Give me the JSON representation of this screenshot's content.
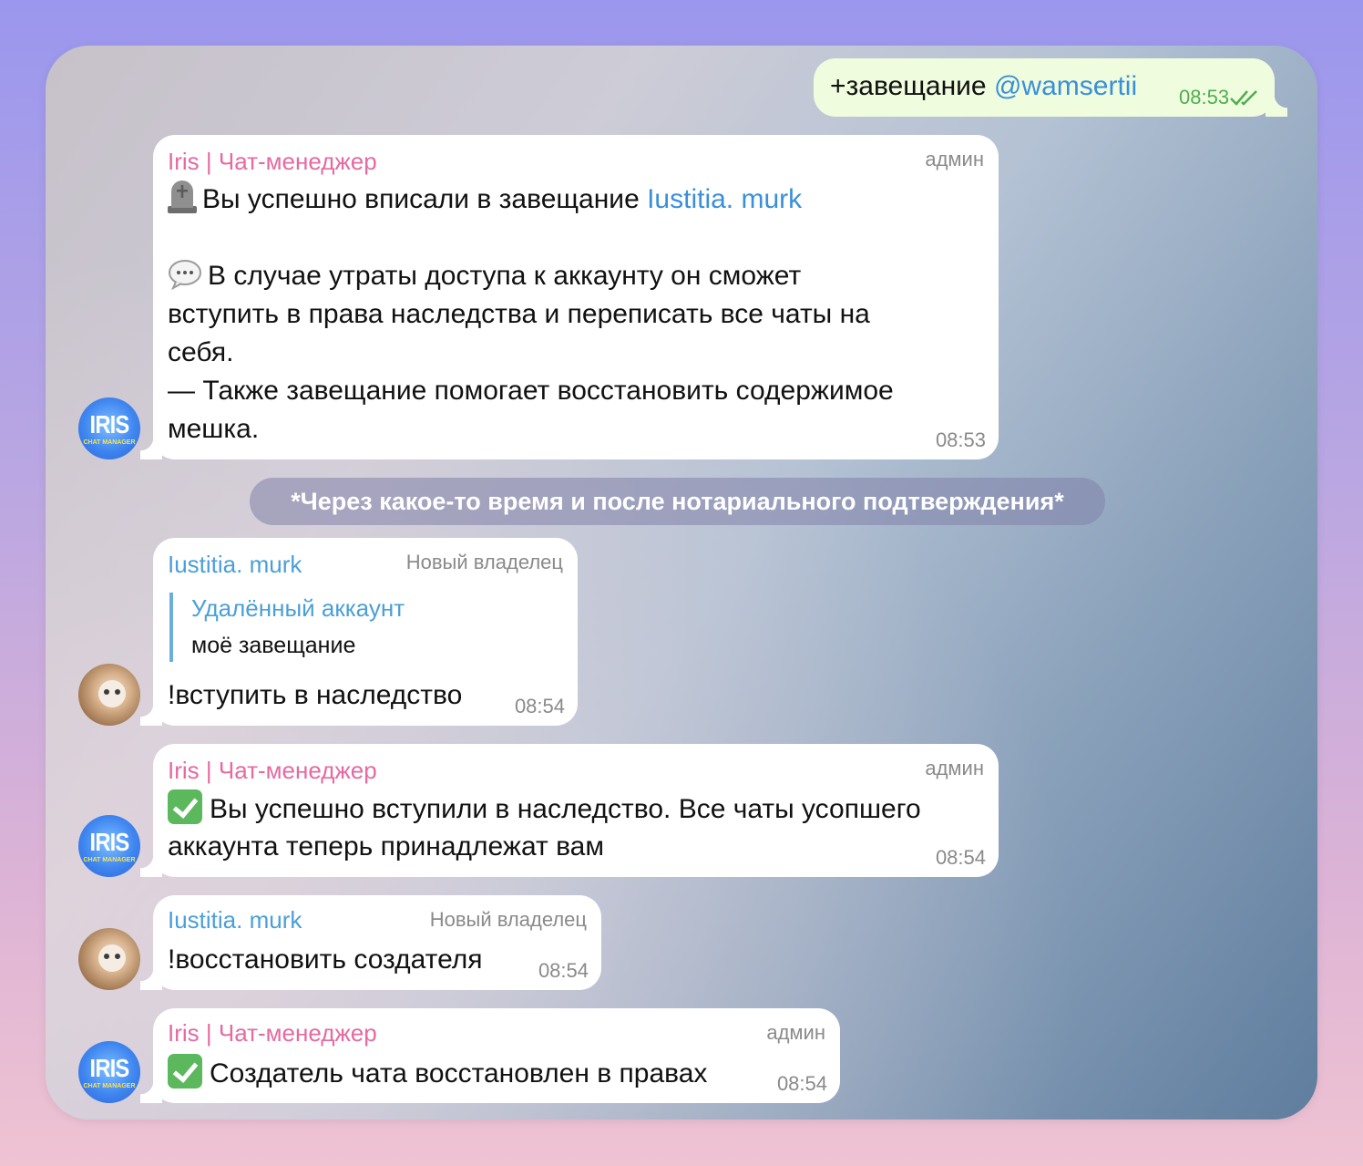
{
  "messages": {
    "m1": {
      "text": "+завещание ",
      "mention": "@wamsertii",
      "time": "08:53"
    },
    "m2": {
      "sender": "Iris | Чат-менеджер",
      "role": "админ",
      "line1_prefix": "Вы успешно вписали в завещание ",
      "line1_link": "Iustitia. murk",
      "line2": "В случае утраты доступа к аккаунту он сможет",
      "line3": "вступить в права наследства и переписать все чаты на",
      "line4": "себя.",
      "line5": "— Также завещание помогает восстановить содержимое",
      "line6": "мешка.",
      "time": "08:53"
    },
    "service": "*Через какое-то время и после нотариального подтверждения*",
    "m3": {
      "sender": "Iustitia. murk",
      "role": "Новый владелец",
      "reply_name": "Удалённый аккаунт",
      "reply_text": "моё завещание",
      "text": "!вступить в наследство",
      "time": "08:54"
    },
    "m4": {
      "sender": "Iris | Чат-менеджер",
      "role": "админ",
      "line1": "Вы успешно вступили в наследство. Все чаты усопшего",
      "line2": "аккаунта теперь принадлежат вам",
      "time": "08:54"
    },
    "m5": {
      "sender": "Iustitia. murk",
      "role": "Новый владелец",
      "text": "!восстановить создателя",
      "time": "08:54"
    },
    "m6": {
      "sender": "Iris | Чат-менеджер",
      "role": "админ",
      "text": "Создатель чата восстановлен в правах",
      "time": "08:54"
    }
  },
  "avatars": {
    "iris_logo": "IRIS",
    "iris_sub": "CHAT MANAGER"
  },
  "icons": [
    "tombstone-icon",
    "speech-bubble-icon",
    "check-mark-icon",
    "double-check-icon"
  ],
  "colors": {
    "sender_pink": "#e56aa1",
    "sender_blue": "#4b9fd8",
    "link": "#3a8fd9",
    "outgoing_bg": "#effcde",
    "time_green": "#4fae4e"
  }
}
